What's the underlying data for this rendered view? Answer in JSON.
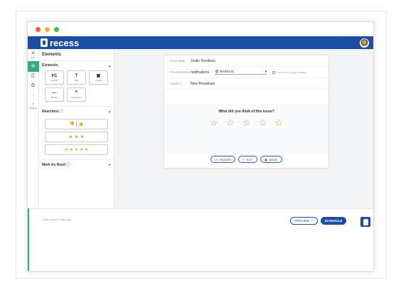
{
  "app": {
    "brand": "recess"
  },
  "rail": {
    "items": [
      {
        "icon": "✕",
        "label": "Exit"
      },
      {
        "icon": "✣",
        "label": ""
      },
      {
        "icon": "⎘",
        "label": ""
      },
      {
        "icon": "⚙",
        "label": ""
      },
      {
        "icon": "◌",
        "label": ""
      },
      {
        "icon": "‹",
        "label": "Collapse"
      }
    ]
  },
  "panel": {
    "title": "Elements",
    "elements_heading": "Elements",
    "elements": [
      {
        "icon": "H1",
        "label": "Header"
      },
      {
        "icon": "T",
        "label": "Text"
      },
      {
        "icon": "▣",
        "label": "Image"
      },
      {
        "icon": "—",
        "label": "Divider"
      },
      {
        "icon": "❞",
        "label": "Quote Box"
      }
    ],
    "reactions_heading": "Reactions",
    "reactions": [
      {
        "content": "👎 | 👍"
      },
      {
        "content": "☻ ☻ ☻"
      },
      {
        "content": "★ ★ ★ ★ ★"
      }
    ],
    "mark_read": "Mark As Read"
  },
  "email": {
    "from_name_label": "FROM NAME",
    "from_name": "Justin Rondeau",
    "from_address_label": "FROM ADDRESS",
    "from_address": "notifications",
    "domain": "@ recess.io",
    "reply_label": "Use this as my reply-to address",
    "subject_label": "SUBJECT",
    "subject": "New Broadcast",
    "question": "What did you think of this issue?",
    "stars": [
      "☆",
      "☆",
      "☆",
      "☆",
      "☆"
    ],
    "toolbar": [
      {
        "icon": "H₁",
        "label": "HEADER"
      },
      {
        "icon": "T",
        "label": "TEXT"
      },
      {
        "icon": "▣",
        "label": "IMAGE"
      }
    ]
  },
  "footer": {
    "saved": "Last saved: a day ago",
    "preview": "PREVIEW",
    "schedule": "SCHEDULE"
  },
  "colors": {
    "brand": "#1e4ea3",
    "accent": "#2fae7f",
    "star": "#e7a621"
  }
}
